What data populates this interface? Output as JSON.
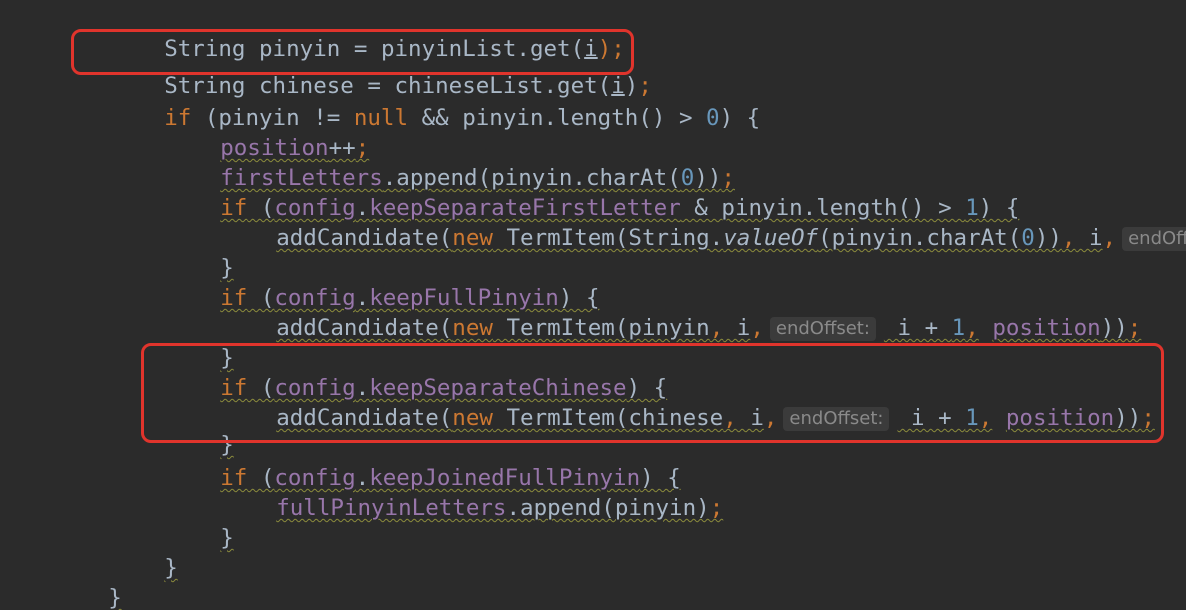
{
  "code": {
    "l1": [
      "String pinyin = ",
      "pinyinList.get(",
      "i",
      ");"
    ],
    "l2": [
      "String chinese = chineseList.get(",
      "i",
      ")",
      ";"
    ],
    "l3": [
      "if",
      " (pinyin != ",
      "null",
      " && pinyin.length() > ",
      "0",
      ") {"
    ],
    "l4": [
      "position",
      "++",
      ";"
    ],
    "l5": [
      "firstLetters",
      ".append(pinyin.charAt(",
      "0",
      "))",
      ";"
    ],
    "l6": [
      "if",
      " (",
      "config",
      ".",
      "keepSeparateFirstLetter",
      " & pinyin.length() > ",
      "1",
      ") {"
    ],
    "l7": [
      "addCandidate(",
      "new",
      " TermItem(String.",
      "valueOf",
      "(pinyin.charAt(",
      "0",
      "))",
      ",",
      " i",
      ","
    ],
    "l7_hint": "endOff",
    "l8": [
      "}"
    ],
    "l9": [
      "if",
      " (",
      "config",
      ".",
      "keepFullPinyin",
      ") {"
    ],
    "l10": [
      "addCandidate(",
      "new",
      " TermItem(pinyin",
      ",",
      " i",
      ","
    ],
    "l10_hint": "endOffset:",
    "l10_tail": [
      " i + ",
      "1",
      ",",
      " ",
      "position",
      "))",
      ";"
    ],
    "l11": [
      "}"
    ],
    "l12": [
      "if",
      " (",
      "config",
      ".",
      "keepSeparateChinese",
      ") {"
    ],
    "l13": [
      "addCandidate(",
      "new",
      " TermItem(chinese",
      ",",
      " i",
      ","
    ],
    "l13_hint": "endOffset:",
    "l13_tail": [
      " i + ",
      "1",
      ",",
      " ",
      "position",
      "))",
      ";"
    ],
    "l14": [
      "}"
    ],
    "l15": [
      "if",
      " (",
      "config",
      ".",
      "keepJoinedFullPinyin",
      ") {"
    ],
    "l16": [
      "fullPinyinLetters",
      ".append(pinyin)",
      ";"
    ],
    "l17": [
      "}"
    ],
    "l18": [
      "}"
    ],
    "l19": [
      "}"
    ]
  },
  "colors": {
    "background": "#2b2b2b",
    "keyword": "#cc7832",
    "field": "#9876aa",
    "number": "#6897bb",
    "text": "#a9b7c6",
    "highlight": "#e0342c"
  }
}
